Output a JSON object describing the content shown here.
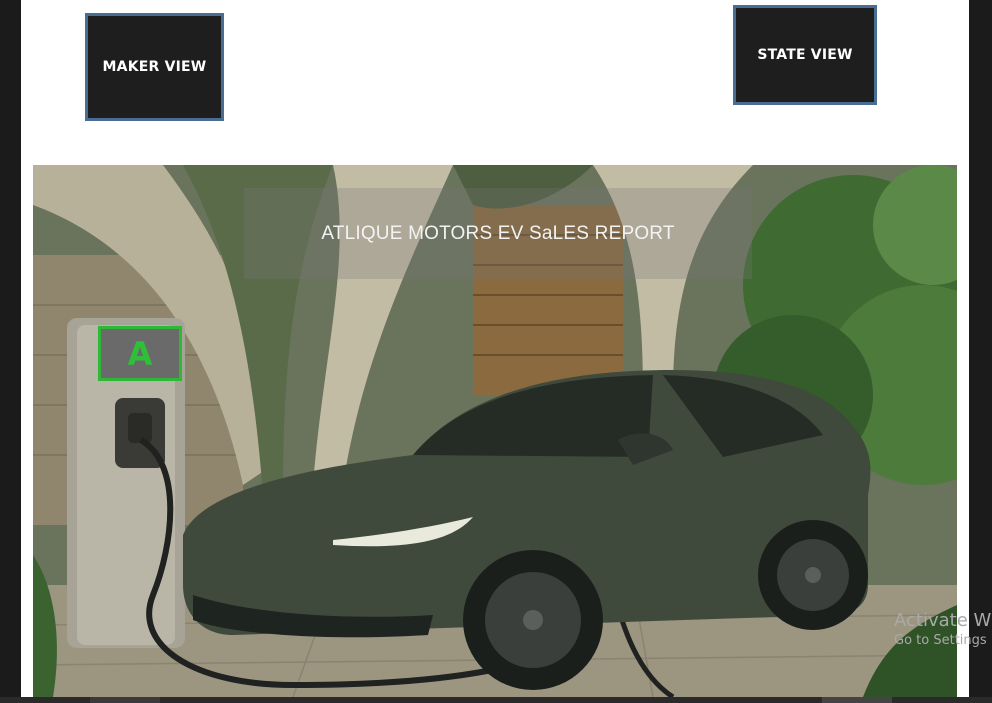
{
  "nav": {
    "maker_label": "MAKER VIEW",
    "state_label": "STATE VIEW"
  },
  "report": {
    "title": "ATLIQUE MOTORS EV SaLES REPORT",
    "logo_letter": "A"
  },
  "watermark": {
    "line1": "Activate Wi",
    "line2": "Go to Settings"
  },
  "colors": {
    "button_bg": "#1e1e1e",
    "button_border": "#4a6d94",
    "logo_accent": "#2db836"
  }
}
